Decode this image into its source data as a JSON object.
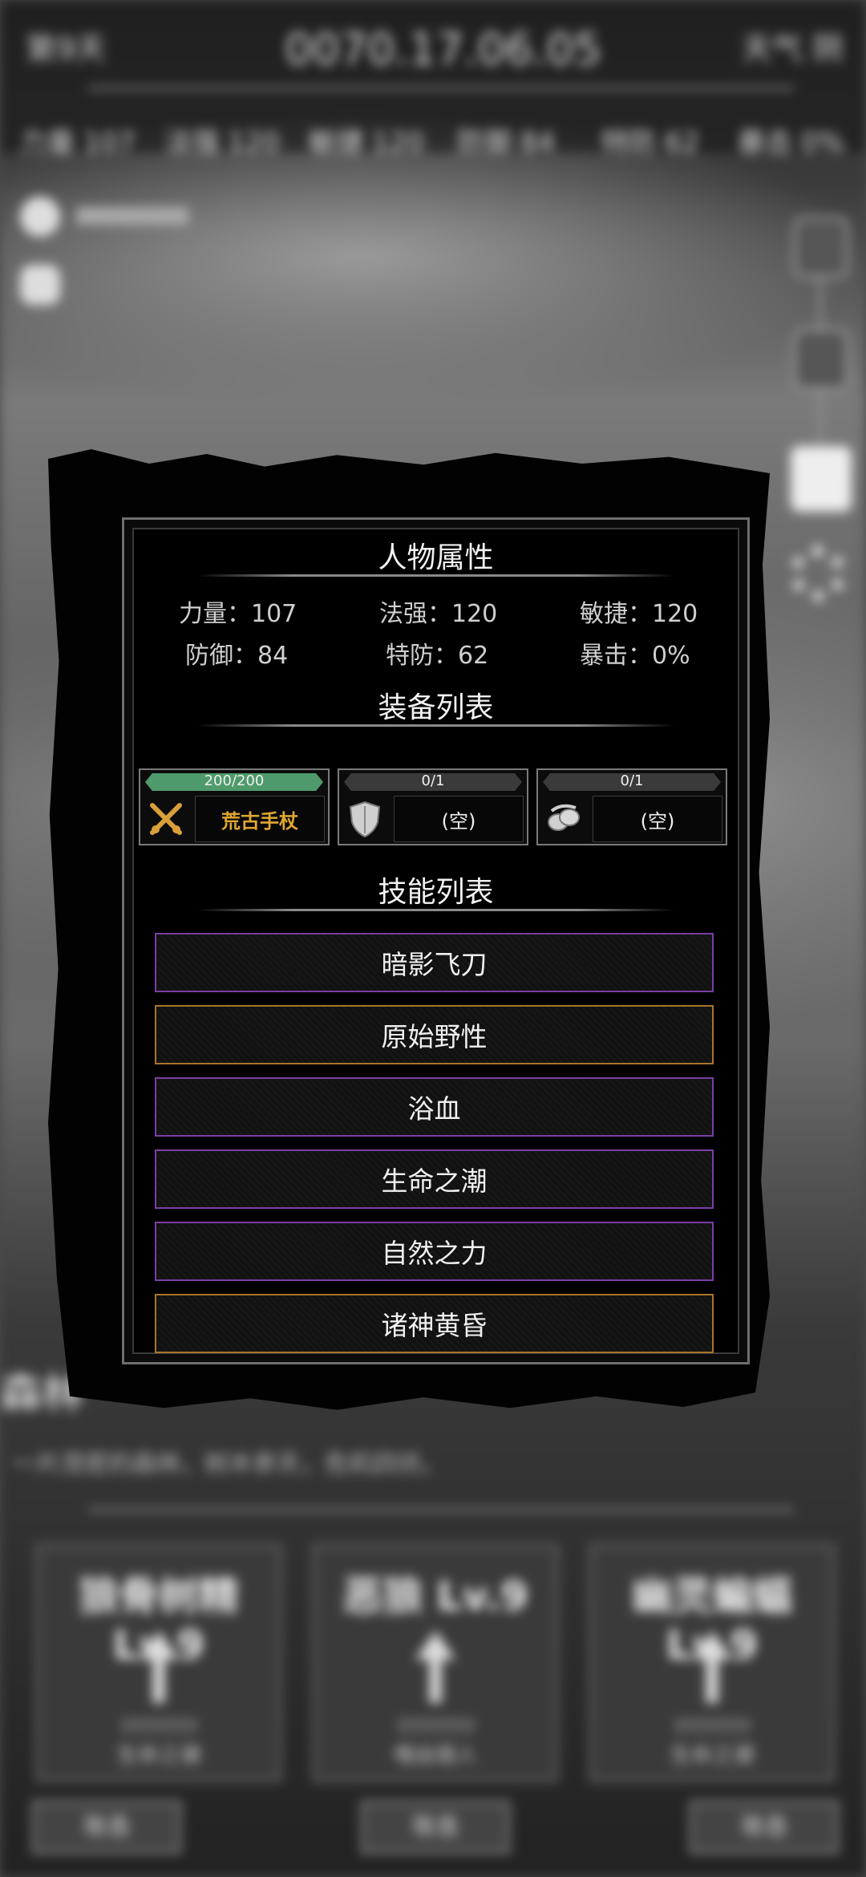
{
  "background": {
    "top_bar": {
      "day": "第9天",
      "clock": "0070.17.06.05",
      "clock_suffix": " ",
      "weather": "天气 阴",
      "stats": [
        "力量 107",
        "法强 120",
        "敏捷 120",
        "防御 84",
        "特防 62",
        "暴击 0%"
      ]
    },
    "region_title": "森林",
    "region_desc": "一片茂密的森林，树木参天，危机四伏。",
    "cards": [
      {
        "title": "狼骨树精 Lv.9",
        "sub1": "???????",
        "sub2": "生命之潮"
      },
      {
        "title": "恶狼 Lv.9",
        "sub1": "???????",
        "sub2": "嗜血猎人"
      },
      {
        "title": "幽灵蝙蝠 Lv.9",
        "sub1": "???????",
        "sub2": "生命之潮"
      }
    ],
    "buttons": [
      "攻击",
      "攻击",
      "攻击"
    ]
  },
  "panel": {
    "attributes_title": "人物属性",
    "attributes": [
      {
        "label": "力量：",
        "value": "107"
      },
      {
        "label": "法强：",
        "value": "120"
      },
      {
        "label": "敏捷：",
        "value": "120"
      },
      {
        "label": "防御：",
        "value": "84"
      },
      {
        "label": "特防：",
        "value": "62"
      },
      {
        "label": "暴击：",
        "value": "0%"
      }
    ],
    "equipment_title": "装备列表",
    "equipment": [
      {
        "durability": "200/200",
        "durability_fraction": 1.0,
        "name": "荒古手杖",
        "icon": "crossed-swords-icon",
        "color": "#e0a733"
      },
      {
        "durability": "0/1",
        "durability_fraction": 0.0,
        "name": "(空)",
        "icon": "shield-icon",
        "color": "#f0f0f0"
      },
      {
        "durability": "0/1",
        "durability_fraction": 0.0,
        "name": "(空)",
        "icon": "accessory-icon",
        "color": "#f0f0f0"
      }
    ],
    "skills_title": "技能列表",
    "skills": [
      {
        "name": "暗影飞刀",
        "rarity_color": "#7b3ea6"
      },
      {
        "name": "原始野性",
        "rarity_color": "#a8752a"
      },
      {
        "name": "浴血",
        "rarity_color": "#7b3ea6"
      },
      {
        "name": "生命之潮",
        "rarity_color": "#7b3ea6"
      },
      {
        "name": "自然之力",
        "rarity_color": "#7b3ea6"
      },
      {
        "name": "诸神黄昏",
        "rarity_color": "#a8752a"
      }
    ]
  }
}
